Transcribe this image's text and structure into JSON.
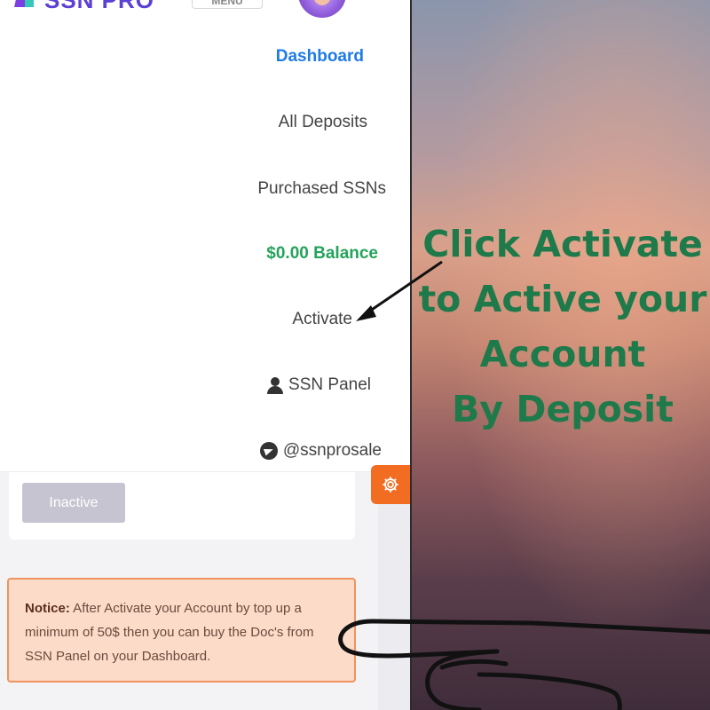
{
  "header": {
    "logo_text": "SSN PRO",
    "menu_button_label": "MENU"
  },
  "menu": {
    "dashboard": "Dashboard",
    "all_deposits": "All Deposits",
    "purchased_ssns": "Purchased SSNs",
    "balance": "$0.00 Balance",
    "activate": "Activate",
    "ssn_panel": "SSN Panel",
    "telegram": "@ssnprosale"
  },
  "status": {
    "inactive_label": "Inactive"
  },
  "notice": {
    "label": "Notice:",
    "text": " After Activate your Account by top up a minimum of 50$ then you can buy the Doc's from SSN Panel on your Dashboard."
  },
  "caption": {
    "line1": "Click Activate",
    "line2": "to Active your",
    "line3": "Account",
    "line4": "By Deposit"
  },
  "colors": {
    "accent_blue": "#1e7be6",
    "balance_green": "#24a35a",
    "caption_green": "#1e7a4a",
    "settings_orange": "#f26d21",
    "notice_bg": "#fddbc9"
  },
  "icons": [
    "user-icon",
    "telegram-icon",
    "gear-icon",
    "arrow-icon",
    "pointing-hand-icon"
  ]
}
